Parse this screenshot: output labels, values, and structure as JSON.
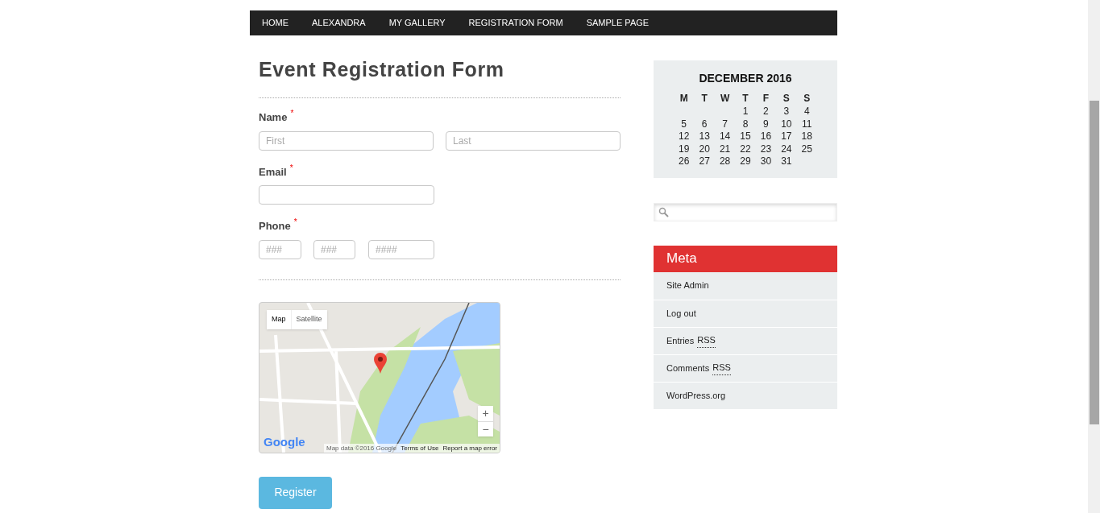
{
  "nav": [
    {
      "label": "HOME"
    },
    {
      "label": "ALEXANDRA"
    },
    {
      "label": "MY GALLERY"
    },
    {
      "label": "REGISTRATION FORM"
    },
    {
      "label": "SAMPLE PAGE"
    }
  ],
  "title": "Event Registration Form",
  "fields": [
    {
      "label": "Name",
      "required_mark": "*",
      "kind": "name",
      "placeholders": [
        "First",
        "Last"
      ]
    },
    {
      "label": "Email",
      "required_mark": "*",
      "kind": "email"
    },
    {
      "label": "Phone",
      "required_mark": "*",
      "kind": "phone",
      "placeholders": [
        "###",
        "###",
        "####"
      ]
    }
  ],
  "map": {
    "types": [
      {
        "label": "Map",
        "selected": true
      },
      {
        "label": "Satellite",
        "selected": false
      }
    ],
    "zoom_in": "+",
    "zoom_out": "−",
    "logo": "Google",
    "footer": [
      {
        "text": "Map data ©2016 Google",
        "kind": "text"
      },
      {
        "text": "Terms of Use",
        "kind": "link"
      },
      {
        "text": "Report a map error",
        "kind": "link"
      }
    ]
  },
  "submit": "Register",
  "calendar": {
    "caption": "DECEMBER 2016",
    "weekdays": [
      "M",
      "T",
      "W",
      "T",
      "F",
      "S",
      "S"
    ],
    "weeks": [
      {
        "kind": "start",
        "days": [
          "1",
          "2",
          "3",
          "4"
        ]
      },
      {
        "kind": "full",
        "days": [
          "5",
          "6",
          "7",
          "8",
          "9",
          "10",
          "11"
        ]
      },
      {
        "kind": "full",
        "days": [
          "12",
          "13",
          "14",
          "15",
          "16",
          "17",
          "18"
        ]
      },
      {
        "kind": "full",
        "days": [
          "19",
          "20",
          "21",
          "22",
          "23",
          "24",
          "25"
        ]
      },
      {
        "kind": "end",
        "days": [
          "26",
          "27",
          "28",
          "29",
          "30",
          "31"
        ]
      }
    ]
  },
  "meta": {
    "title": "Meta",
    "items": [
      {
        "text": "Site Admin"
      },
      {
        "text": "Log out"
      },
      {
        "text": "Entries",
        "abbr": "RSS"
      },
      {
        "text": "Comments",
        "abbr": "RSS"
      },
      {
        "text": "WordPress.org"
      }
    ]
  }
}
